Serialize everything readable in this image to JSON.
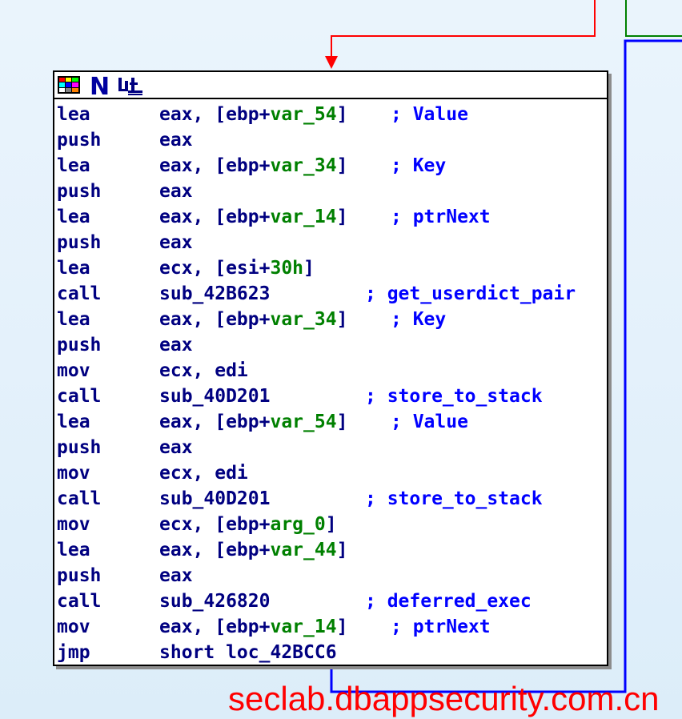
{
  "node": {
    "toolbar": [
      {
        "name": "graph-colors-icon",
        "glyph": "palette"
      },
      {
        "name": "node-rename-icon",
        "glyph": "N"
      },
      {
        "name": "group-nodes-icon",
        "glyph": "group"
      }
    ],
    "lines": [
      {
        "mn": "lea",
        "ops": [
          {
            "t": "eax, [ebp+"
          },
          {
            "t": "var_54",
            "c": "var"
          },
          {
            "t": "]"
          }
        ],
        "comment": "; Value",
        "cpos": "a"
      },
      {
        "mn": "push",
        "ops": [
          {
            "t": "eax"
          }
        ]
      },
      {
        "mn": "lea",
        "ops": [
          {
            "t": "eax, [ebp+"
          },
          {
            "t": "var_34",
            "c": "var"
          },
          {
            "t": "]"
          }
        ],
        "comment": "; Key",
        "cpos": "a"
      },
      {
        "mn": "push",
        "ops": [
          {
            "t": "eax"
          }
        ]
      },
      {
        "mn": "lea",
        "ops": [
          {
            "t": "eax, [ebp+"
          },
          {
            "t": "var_14",
            "c": "var"
          },
          {
            "t": "]"
          }
        ],
        "comment": "; ptrNext",
        "cpos": "a"
      },
      {
        "mn": "push",
        "ops": [
          {
            "t": "eax"
          }
        ]
      },
      {
        "mn": "lea",
        "ops": [
          {
            "t": "ecx, [esi+"
          },
          {
            "t": "30h",
            "c": "hex"
          },
          {
            "t": "]"
          }
        ]
      },
      {
        "mn": "call",
        "ops": [
          {
            "t": "sub_42B623"
          }
        ],
        "comment": "; get_userdict_pair",
        "cpos": "b"
      },
      {
        "mn": "lea",
        "ops": [
          {
            "t": "eax, [ebp+"
          },
          {
            "t": "var_34",
            "c": "var"
          },
          {
            "t": "]"
          }
        ],
        "comment": "; Key",
        "cpos": "a"
      },
      {
        "mn": "push",
        "ops": [
          {
            "t": "eax"
          }
        ]
      },
      {
        "mn": "mov",
        "ops": [
          {
            "t": "ecx, edi"
          }
        ]
      },
      {
        "mn": "call",
        "ops": [
          {
            "t": "sub_40D201"
          }
        ],
        "comment": "; store_to_stack",
        "cpos": "b"
      },
      {
        "mn": "lea",
        "ops": [
          {
            "t": "eax, [ebp+"
          },
          {
            "t": "var_54",
            "c": "var"
          },
          {
            "t": "]"
          }
        ],
        "comment": "; Value",
        "cpos": "a"
      },
      {
        "mn": "push",
        "ops": [
          {
            "t": "eax"
          }
        ]
      },
      {
        "mn": "mov",
        "ops": [
          {
            "t": "ecx, edi"
          }
        ]
      },
      {
        "mn": "call",
        "ops": [
          {
            "t": "sub_40D201"
          }
        ],
        "comment": "; store_to_stack",
        "cpos": "b"
      },
      {
        "mn": "mov",
        "ops": [
          {
            "t": "ecx, [ebp+"
          },
          {
            "t": "arg_0",
            "c": "var"
          },
          {
            "t": "]"
          }
        ]
      },
      {
        "mn": "lea",
        "ops": [
          {
            "t": "eax, [ebp+"
          },
          {
            "t": "var_44",
            "c": "var"
          },
          {
            "t": "]"
          }
        ]
      },
      {
        "mn": "push",
        "ops": [
          {
            "t": "eax"
          }
        ]
      },
      {
        "mn": "call",
        "ops": [
          {
            "t": "sub_426820"
          }
        ],
        "comment": "; deferred_exec",
        "cpos": "b"
      },
      {
        "mn": "mov",
        "ops": [
          {
            "t": "eax, [ebp+"
          },
          {
            "t": "var_14",
            "c": "var"
          },
          {
            "t": "]"
          }
        ],
        "comment": "; ptrNext",
        "cpos": "a"
      },
      {
        "mn": "jmp",
        "ops": [
          {
            "t": "short loc_42BCC6"
          }
        ]
      }
    ]
  },
  "edges": {
    "incoming_color": "#ff0000",
    "outgoing_color": "#0000ff",
    "other_color": "#008000"
  },
  "colors": {
    "mnemonic": "#000080",
    "variable": "#008000",
    "comment": "#0000ff",
    "background": "#e4f1fb"
  },
  "watermark": "seclab.dbappsecurity.com.cn"
}
